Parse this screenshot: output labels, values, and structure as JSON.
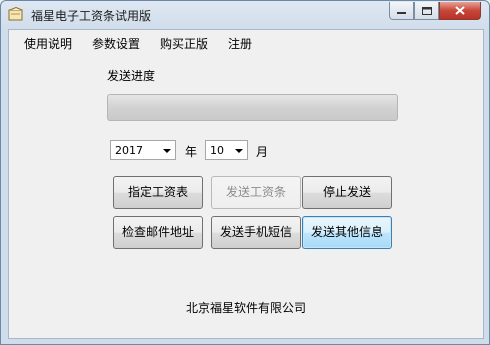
{
  "window": {
    "title": "福星电子工资条试用版"
  },
  "menu": {
    "items": [
      "使用说明",
      "参数设置",
      "购买正版",
      "注册"
    ]
  },
  "progress": {
    "label": "发送进度",
    "value": 0
  },
  "date": {
    "year": "2017",
    "year_suffix": "年",
    "month": "10",
    "month_suffix": "月"
  },
  "buttons": {
    "designate_payslip": "指定工资表",
    "send_payslip": "发送工资条",
    "stop_sending": "停止发送",
    "check_email": "检查邮件地址",
    "send_sms": "发送手机短信",
    "send_other": "发送其他信息"
  },
  "footer": {
    "company": "北京福星软件有限公司"
  },
  "colors": {
    "title_bar": "#cfdcea",
    "close_button": "#c7463a",
    "focused_button": "#bee6fd"
  }
}
